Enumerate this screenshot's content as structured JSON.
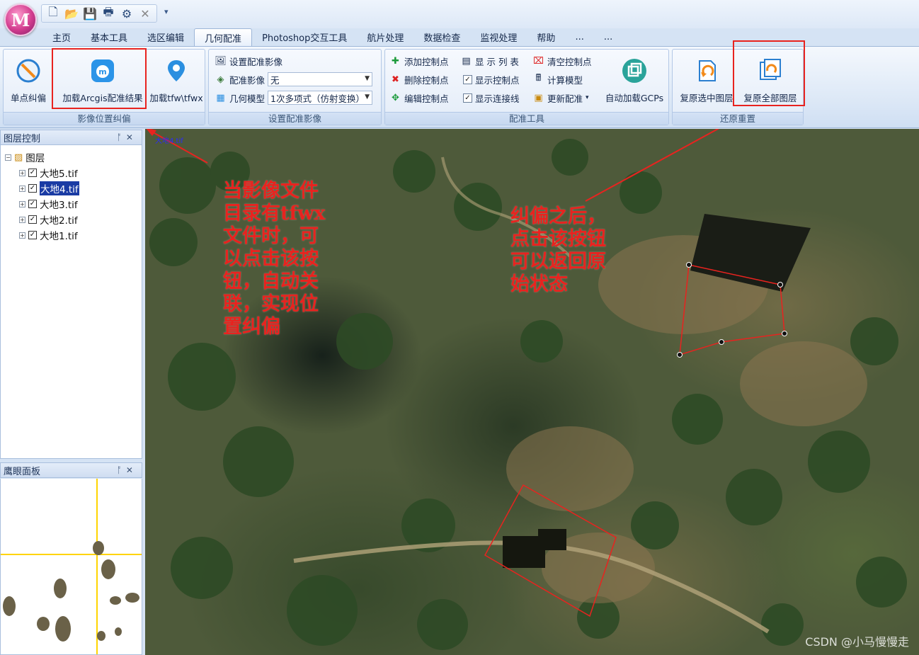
{
  "app": {
    "logo_letter": "M"
  },
  "quick_access": {
    "more_label": "▾"
  },
  "tabs": [
    {
      "label": "主页"
    },
    {
      "label": "基本工具"
    },
    {
      "label": "选区编辑"
    },
    {
      "label": "几何配准"
    },
    {
      "label": "Photoshop交互工具"
    },
    {
      "label": "航片处理"
    },
    {
      "label": "数据检查"
    },
    {
      "label": "监视处理"
    },
    {
      "label": "帮助"
    },
    {
      "label": "..."
    },
    {
      "label": "..."
    }
  ],
  "ribbon": {
    "group1": {
      "label": "影像位置纠偏",
      "single_rectify": "单点纠偏",
      "load_arcgis": "加载Arcgis配准结果",
      "load_tfw": "加载tfw\\tfwx"
    },
    "group2": {
      "label": "设置配准影像",
      "set_image": "设置配准影像",
      "reg_image_label": "配准影像",
      "reg_image_value": "无",
      "geo_model_label": "几何模型",
      "geo_model_value": "1次多项式（仿射变换）"
    },
    "group3": {
      "label": "配准工具",
      "add_point": "添加控制点",
      "delete_point": "删除控制点",
      "edit_point": "编辑控制点",
      "show_list": "显 示 列 表",
      "show_points": "显示控制点",
      "show_links": "显示连接线",
      "clear_points": "清空控制点",
      "calc_model": "计算模型",
      "update_reg": "更新配准",
      "auto_gcps": "自动加载GCPs"
    },
    "group4": {
      "label": "还原重置",
      "restore_selected": "复原选中图层",
      "restore_all": "复原全部图层"
    }
  },
  "layer_panel": {
    "title": "图层控制",
    "root": "图层",
    "layers": [
      "大地5.tif",
      "大地4.tif",
      "大地3.tif",
      "大地2.tif",
      "大地1.tif"
    ]
  },
  "eagle_panel": {
    "title": "鹰眼面板"
  },
  "map": {
    "annotation_left": "当影像文件\n目录有tfwx\n文件时，可\n以点击该按\n钮，自动关\n联，实现位\n置纠偏",
    "annotation_right": "纠偏之后，\n点击该按钮\n可以返回原\n始状态",
    "corner_label": "大地4.tif",
    "watermark": "CSDN @小马慢慢走"
  },
  "colors": {
    "annotation": "#e8231f",
    "selection": "#1a3ba4"
  }
}
